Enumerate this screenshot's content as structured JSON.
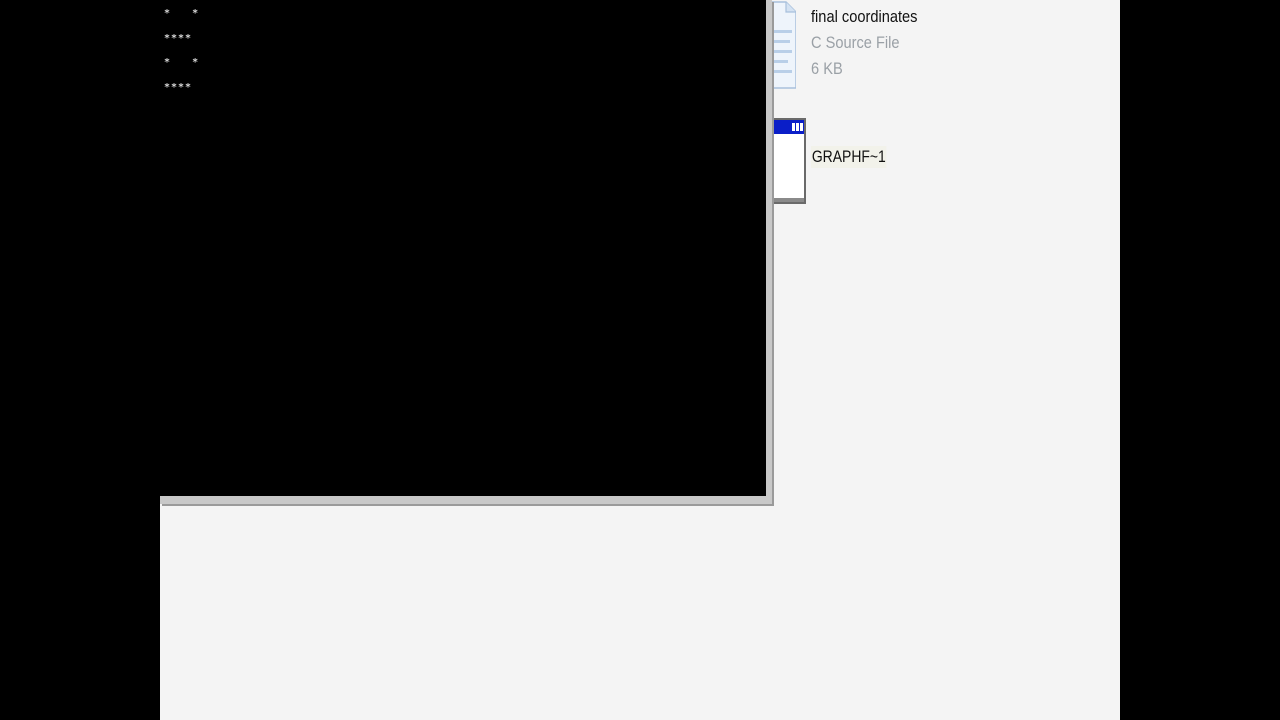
{
  "console": {
    "output_lines": [
      "*   *",
      "****",
      "*   *",
      "****"
    ]
  },
  "files": [
    {
      "name": "final coordinates",
      "type": "C Source File",
      "size": "6 KB",
      "icon": "c-source-file-icon"
    },
    {
      "name": "GRAPHF~1",
      "icon": "ms-dos-program-icon"
    }
  ],
  "colors": {
    "console_bg": "#000000",
    "console_text": "#d8d8d8",
    "explorer_bg": "#f4f4f4",
    "titlebar_blue": "#0a1ec8",
    "meta_text": "#9aa0a6"
  }
}
